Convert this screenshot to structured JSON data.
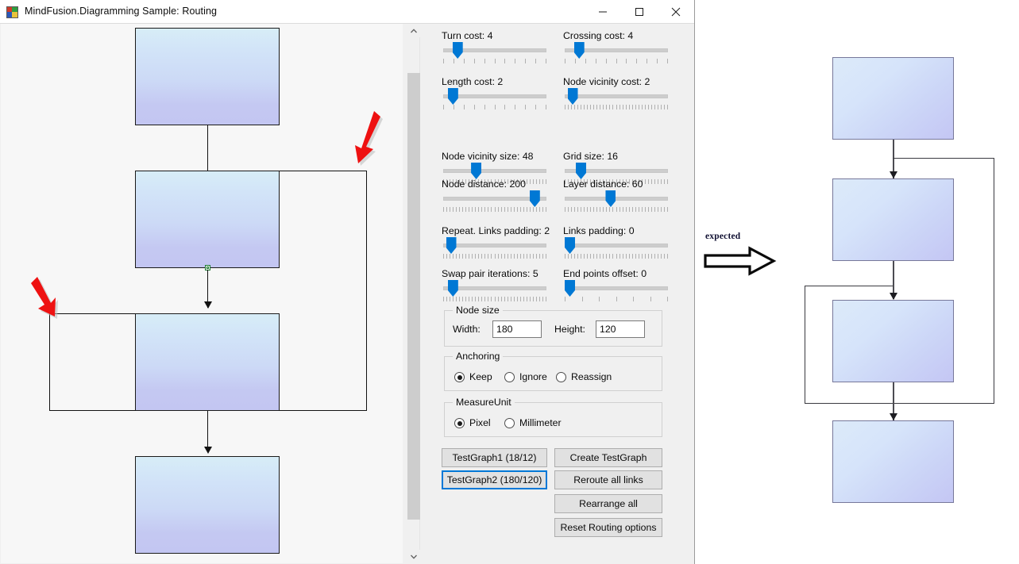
{
  "window": {
    "title": "MindFusion.Diagramming Sample: Routing",
    "icon": "app-icon",
    "controls": {
      "minimize": "minimize-icon",
      "maximize": "maximize-icon",
      "close": "close-icon"
    }
  },
  "canvas": {
    "name": "routing-diagram-canvas",
    "annotations": [
      {
        "name": "red-arrow-top",
        "color": "#ee1111"
      },
      {
        "name": "red-arrow-left",
        "color": "#ee1111"
      }
    ]
  },
  "options": {
    "sliders": [
      {
        "label": "Turn cost: 4",
        "value": 4,
        "pos": 0.1,
        "ticks": 11,
        "name": "turn-cost-slider"
      },
      {
        "label": "Crossing cost: 4",
        "value": 4,
        "pos": 0.1,
        "ticks": 11,
        "name": "crossing-cost-slider"
      },
      {
        "label": "Length cost: 2",
        "value": 2,
        "pos": 0.05,
        "ticks": 11,
        "name": "length-cost-slider"
      },
      {
        "label": "Node vicinity cost: 2",
        "value": 2,
        "pos": 0.03,
        "ticks": 33,
        "name": "node-vicinity-cost-slider"
      },
      {
        "label": "Node vicinity size: 48",
        "value": 48,
        "pos": 0.3,
        "ticks": 33,
        "name": "node-vicinity-size-slider"
      },
      {
        "label": "Grid size: 16",
        "value": 16,
        "pos": 0.12,
        "ticks": 33,
        "name": "grid-size-slider"
      },
      {
        "label": "Node distance: 200",
        "value": 200,
        "pos": 0.93,
        "ticks": 33,
        "name": "node-distance-slider"
      },
      {
        "label": "Layer distance: 60",
        "value": 60,
        "pos": 0.44,
        "ticks": 33,
        "name": "layer-distance-slider"
      },
      {
        "label": "Repeat. Links padding: 2",
        "value": 2,
        "pos": 0.03,
        "ticks": 33,
        "name": "repeat-links-padding-slider"
      },
      {
        "label": "Links padding: 0",
        "value": 0,
        "pos": 0.0,
        "ticks": 33,
        "name": "links-padding-slider"
      },
      {
        "label": "Swap pair iterations: 5",
        "value": 5,
        "pos": 0.05,
        "ticks": 33,
        "name": "swap-pair-iterations-slider"
      },
      {
        "label": "End points offset: 0",
        "value": 0,
        "pos": 0.0,
        "ticks": 7,
        "name": "end-points-offset-slider"
      }
    ],
    "node_size": {
      "title": "Node size",
      "width_label": "Width:",
      "width_value": "180",
      "height_label": "Height:",
      "height_value": "120"
    },
    "anchoring": {
      "title": "Anchoring",
      "options": [
        {
          "label": "Keep",
          "selected": true
        },
        {
          "label": "Ignore",
          "selected": false
        },
        {
          "label": "Reassign",
          "selected": false
        }
      ]
    },
    "measure_unit": {
      "title": "MeasureUnit",
      "options": [
        {
          "label": "Pixel",
          "selected": true
        },
        {
          "label": "Millimeter",
          "selected": false
        }
      ]
    },
    "buttons": {
      "left": [
        {
          "label": "TestGraph1 (18/12)",
          "focused": false,
          "name": "testgraph1-button"
        },
        {
          "label": "TestGraph2 (180/120)",
          "focused": true,
          "name": "testgraph2-button"
        }
      ],
      "right": [
        {
          "label": "Create TestGraph",
          "name": "create-testgraph-button"
        },
        {
          "label": "Reroute all links",
          "name": "reroute-all-links-button"
        },
        {
          "label": "Rearrange all",
          "name": "rearrange-all-button"
        },
        {
          "label": "Reset Routing options",
          "name": "reset-routing-options-button"
        }
      ]
    },
    "scrollbar": {
      "up_arrow": "chevron-up-icon",
      "down_arrow": "chevron-down-icon"
    }
  },
  "expected": {
    "label": "expected",
    "arrow": "right-arrow-outline"
  },
  "colors": {
    "accent": "#0078d4",
    "focus_border": "#0078d7",
    "annotation_red": "#ee1111",
    "node_fill_top": "#d7edf7",
    "node_fill_bottom": "#c3c6f2",
    "canvas_bg": "#f7f7f7",
    "panel_bg": "#f0f0f0"
  }
}
